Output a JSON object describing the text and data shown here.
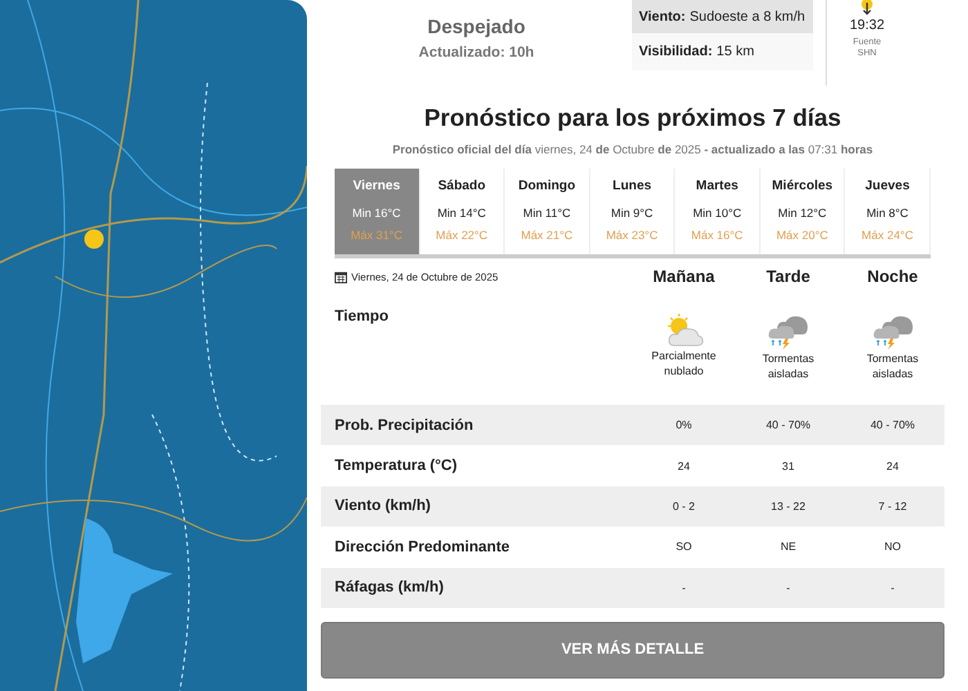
{
  "current": {
    "condition": "Despejado",
    "updated": "Actualizado: 10h",
    "details": [
      {
        "label": "Viento:",
        "value": "Sudoeste a 8 km/h",
        "shaded": true
      },
      {
        "label": "Visibilidad:",
        "value": "15 km",
        "shaded": false
      }
    ],
    "sunset_time": "19:32",
    "source_label": "Fuente",
    "source_value": "SHN"
  },
  "forecast": {
    "title": "Pronóstico para los próximos 7 días",
    "subtitle": "**Pronóstico oficial del día** viernes, 24 **de** Octubre **de** 2025 **- actualizado a las** 07:31 **horas**",
    "days": [
      {
        "name": "Viernes",
        "min": "Min 16°C",
        "max": "Máx 31°C",
        "selected": true
      },
      {
        "name": "Sábado",
        "min": "Min 14°C",
        "max": "Máx 22°C",
        "selected": false
      },
      {
        "name": "Domingo",
        "min": "Min 11°C",
        "max": "Máx 21°C",
        "selected": false
      },
      {
        "name": "Lunes",
        "min": "Min 9°C",
        "max": "Máx 23°C",
        "selected": false
      },
      {
        "name": "Martes",
        "min": "Min 10°C",
        "max": "Máx 16°C",
        "selected": false
      },
      {
        "name": "Miércoles",
        "min": "Min 12°C",
        "max": "Máx 20°C",
        "selected": false
      },
      {
        "name": "Jueves",
        "min": "Min 8°C",
        "max": "Máx 24°C",
        "selected": false
      }
    ],
    "date": "Viernes, 24 de Octubre de 2025",
    "periods": [
      "Mañana",
      "Tarde",
      "Noche"
    ],
    "weather_label": "Tiempo",
    "weather": [
      {
        "kind": "partly_cloudy",
        "description": "Parcialmente nublado"
      },
      {
        "kind": "storm",
        "description": "Tormentas aisladas"
      },
      {
        "kind": "storm",
        "description": "Tormentas aisladas"
      }
    ],
    "rows": [
      {
        "label": "Prob. Precipitación",
        "values": [
          "0%",
          "40 - 70%",
          "40 - 70%"
        ]
      },
      {
        "label": "Temperatura (°C)",
        "values": [
          "24",
          "31",
          "24"
        ]
      },
      {
        "label": "Viento (km/h)",
        "values": [
          "0 - 2",
          "13 - 22",
          "7 - 12"
        ]
      },
      {
        "label": "Dirección Predominante",
        "values": [
          "SO",
          "NE",
          "NO"
        ]
      },
      {
        "label": "Ráfagas (km/h)",
        "values": [
          "-",
          "-",
          "-"
        ]
      }
    ],
    "button": "VER MÁS DETALLE"
  }
}
